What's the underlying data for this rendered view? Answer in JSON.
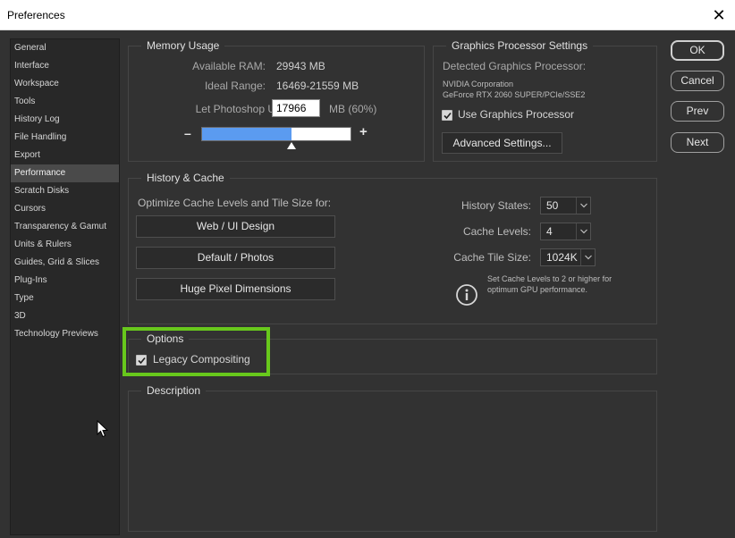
{
  "window": {
    "title": "Preferences"
  },
  "sidebar": {
    "items": [
      {
        "label": "General"
      },
      {
        "label": "Interface"
      },
      {
        "label": "Workspace"
      },
      {
        "label": "Tools"
      },
      {
        "label": "History Log"
      },
      {
        "label": "File Handling"
      },
      {
        "label": "Export"
      },
      {
        "label": "Performance",
        "selected": true
      },
      {
        "label": "Scratch Disks"
      },
      {
        "label": "Cursors"
      },
      {
        "label": "Transparency & Gamut"
      },
      {
        "label": "Units & Rulers"
      },
      {
        "label": "Guides, Grid & Slices"
      },
      {
        "label": "Plug-Ins"
      },
      {
        "label": "Type"
      },
      {
        "label": "3D"
      },
      {
        "label": "Technology Previews"
      }
    ]
  },
  "memory": {
    "legend": "Memory Usage",
    "available_label": "Available RAM:",
    "available_value": "29943 MB",
    "ideal_label": "Ideal Range:",
    "ideal_value": "16469-21559 MB",
    "let_use_label": "Let Photoshop Use:",
    "let_use_value": "17966",
    "let_use_unit": "MB (60%)",
    "minus": "–",
    "plus": "+",
    "slider_fraction": 0.6
  },
  "gpu": {
    "legend": "Graphics Processor Settings",
    "detected_label": "Detected Graphics Processor:",
    "vendor": "NVIDIA Corporation",
    "model": "GeForce RTX 2060 SUPER/PCIe/SSE2",
    "use_gpu_label": "Use Graphics Processor",
    "use_gpu_checked": true,
    "advanced_button": "Advanced Settings..."
  },
  "history_cache": {
    "legend": "History & Cache",
    "optimize_label": "Optimize Cache Levels and Tile Size for:",
    "buttons": [
      "Web / UI Design",
      "Default / Photos",
      "Huge Pixel Dimensions"
    ],
    "history_states_label": "History States:",
    "history_states_value": "50",
    "cache_levels_label": "Cache Levels:",
    "cache_levels_value": "4",
    "tile_size_label": "Cache Tile Size:",
    "tile_size_value": "1024K",
    "info_line1": "Set Cache Levels to 2 or higher for",
    "info_line2": "optimum GPU performance."
  },
  "options": {
    "legend": "Options",
    "legacy_label": "Legacy Compositing",
    "legacy_checked": true
  },
  "description": {
    "legend": "Description"
  },
  "actions": {
    "ok": "OK",
    "cancel": "Cancel",
    "prev": "Prev",
    "next": "Next"
  },
  "colors": {
    "highlight": "#68c81c",
    "slider_fill": "#5b9bf0",
    "selected_item": "#4a4a4a"
  }
}
